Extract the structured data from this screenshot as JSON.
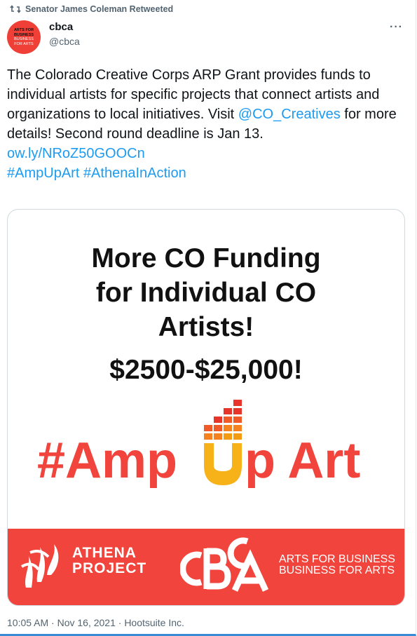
{
  "retweet": {
    "text": "Senator James Coleman Retweeted",
    "icon": "retweet-icon"
  },
  "author": {
    "name": "cbca",
    "handle": "@cbca",
    "avatar_lines": [
      "ARTS FOR",
      "BUSINESS",
      "BUSINESS",
      "FOR ARTS"
    ]
  },
  "more_label": "···",
  "tweet": {
    "text_1": "The Colorado Creative Corps ARP Grant provides funds to individual artists for specific projects that connect artists and organizations to local initiatives. Visit ",
    "mention": "@CO_Creatives",
    "text_2": " for more details! Second round deadline is Jan 13.",
    "url": "ow.ly/NRoZ50GOOCn",
    "hashtag_1": "#AmpUpArt",
    "hashtag_2": "#AthenaInAction"
  },
  "card": {
    "headline_1": "More CO Funding",
    "headline_2": "for Individual CO",
    "headline_3": "Artists!",
    "amount": "$2500-$25,000!",
    "amp_left": "#Amp",
    "amp_right": "p Art",
    "athena_1": "ATHENA",
    "athena_2": "PROJECT",
    "cbca_logo": "CBCA",
    "cbca_line_1": "ARTS FOR BUSINESS",
    "cbca_line_2": "BUSINESS FOR ARTS",
    "colors": {
      "brand_red": "#f0443c",
      "bars_orange": "#f39c12",
      "bars_red": "#e8352b"
    }
  },
  "meta": "10:05 AM · Nov 16, 2021 · Hootsuite Inc."
}
